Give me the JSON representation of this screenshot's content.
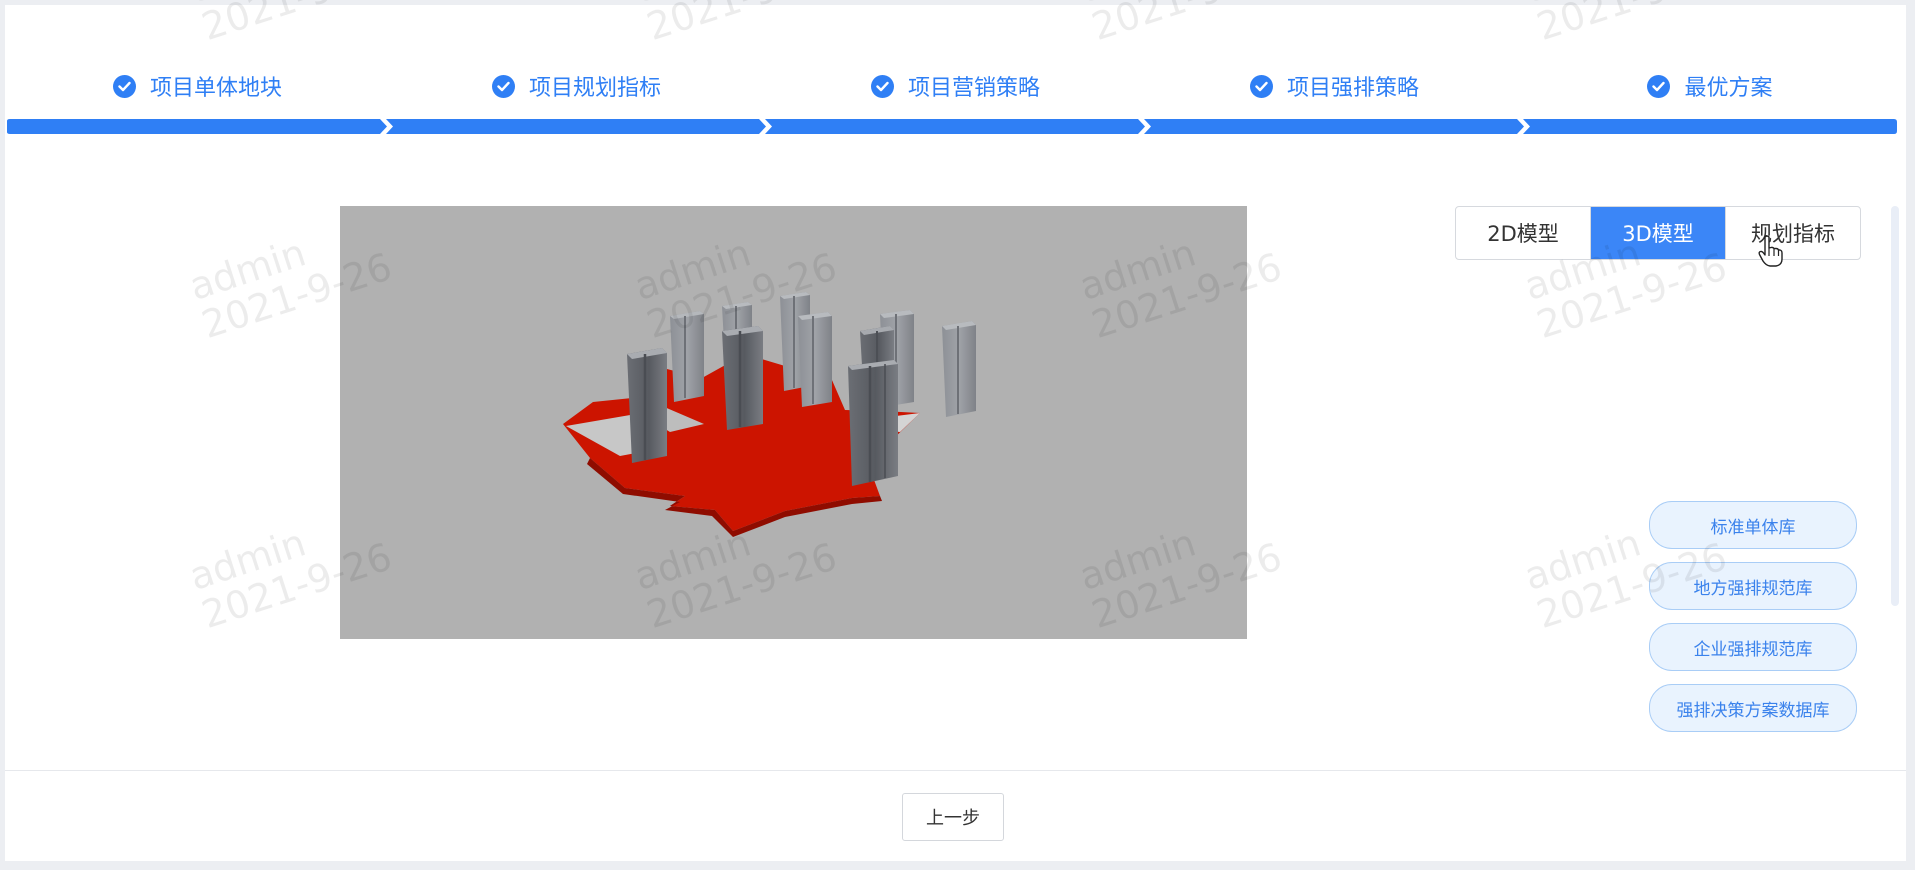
{
  "steps": [
    {
      "label": "项目单体地块"
    },
    {
      "label": "项目规划指标"
    },
    {
      "label": "项目营销策略"
    },
    {
      "label": "项目强排策略"
    },
    {
      "label": "最优方案"
    }
  ],
  "view_tabs": {
    "tab_2d": "2D模型",
    "tab_3d": "3D模型",
    "tab_indicators": "规划指标",
    "active": "3D模型"
  },
  "libraries": {
    "standard_unit": "标准单体库",
    "local_regulation": "地方强排规范库",
    "enterprise_regulation": "企业强排规范库",
    "decision_database": "强排决策方案数据库"
  },
  "footer": {
    "prev_label": "上一步"
  },
  "watermark": {
    "user": "admin",
    "date": "2021-9-26"
  },
  "colors": {
    "accent": "#2f7ff5",
    "active_tab": "#3b86f7",
    "site_plot": "#cc1400",
    "viewport_bg": "#b1b1b1"
  }
}
